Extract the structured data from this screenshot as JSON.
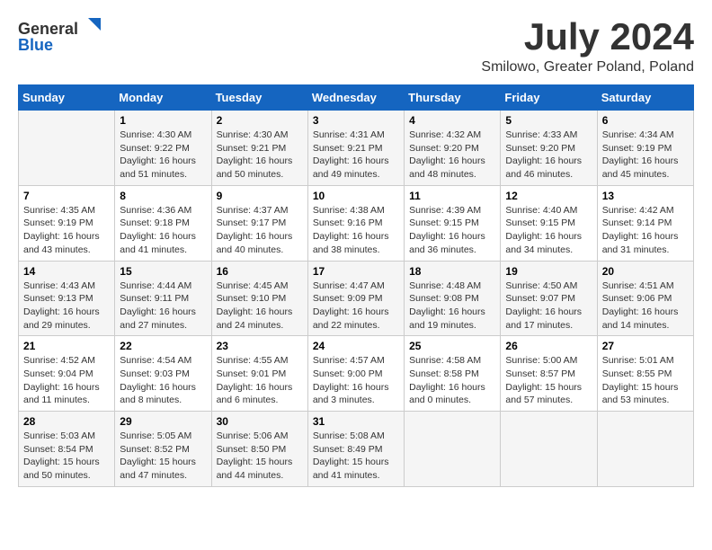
{
  "header": {
    "logo_general": "General",
    "logo_blue": "Blue",
    "month_title": "July 2024",
    "location": "Smilowo, Greater Poland, Poland"
  },
  "weekdays": [
    "Sunday",
    "Monday",
    "Tuesday",
    "Wednesday",
    "Thursday",
    "Friday",
    "Saturday"
  ],
  "weeks": [
    [
      {
        "day": "",
        "sunrise": "",
        "sunset": "",
        "daylight": ""
      },
      {
        "day": "1",
        "sunrise": "Sunrise: 4:30 AM",
        "sunset": "Sunset: 9:22 PM",
        "daylight": "Daylight: 16 hours and 51 minutes."
      },
      {
        "day": "2",
        "sunrise": "Sunrise: 4:30 AM",
        "sunset": "Sunset: 9:21 PM",
        "daylight": "Daylight: 16 hours and 50 minutes."
      },
      {
        "day": "3",
        "sunrise": "Sunrise: 4:31 AM",
        "sunset": "Sunset: 9:21 PM",
        "daylight": "Daylight: 16 hours and 49 minutes."
      },
      {
        "day": "4",
        "sunrise": "Sunrise: 4:32 AM",
        "sunset": "Sunset: 9:20 PM",
        "daylight": "Daylight: 16 hours and 48 minutes."
      },
      {
        "day": "5",
        "sunrise": "Sunrise: 4:33 AM",
        "sunset": "Sunset: 9:20 PM",
        "daylight": "Daylight: 16 hours and 46 minutes."
      },
      {
        "day": "6",
        "sunrise": "Sunrise: 4:34 AM",
        "sunset": "Sunset: 9:19 PM",
        "daylight": "Daylight: 16 hours and 45 minutes."
      }
    ],
    [
      {
        "day": "7",
        "sunrise": "Sunrise: 4:35 AM",
        "sunset": "Sunset: 9:19 PM",
        "daylight": "Daylight: 16 hours and 43 minutes."
      },
      {
        "day": "8",
        "sunrise": "Sunrise: 4:36 AM",
        "sunset": "Sunset: 9:18 PM",
        "daylight": "Daylight: 16 hours and 41 minutes."
      },
      {
        "day": "9",
        "sunrise": "Sunrise: 4:37 AM",
        "sunset": "Sunset: 9:17 PM",
        "daylight": "Daylight: 16 hours and 40 minutes."
      },
      {
        "day": "10",
        "sunrise": "Sunrise: 4:38 AM",
        "sunset": "Sunset: 9:16 PM",
        "daylight": "Daylight: 16 hours and 38 minutes."
      },
      {
        "day": "11",
        "sunrise": "Sunrise: 4:39 AM",
        "sunset": "Sunset: 9:15 PM",
        "daylight": "Daylight: 16 hours and 36 minutes."
      },
      {
        "day": "12",
        "sunrise": "Sunrise: 4:40 AM",
        "sunset": "Sunset: 9:15 PM",
        "daylight": "Daylight: 16 hours and 34 minutes."
      },
      {
        "day": "13",
        "sunrise": "Sunrise: 4:42 AM",
        "sunset": "Sunset: 9:14 PM",
        "daylight": "Daylight: 16 hours and 31 minutes."
      }
    ],
    [
      {
        "day": "14",
        "sunrise": "Sunrise: 4:43 AM",
        "sunset": "Sunset: 9:13 PM",
        "daylight": "Daylight: 16 hours and 29 minutes."
      },
      {
        "day": "15",
        "sunrise": "Sunrise: 4:44 AM",
        "sunset": "Sunset: 9:11 PM",
        "daylight": "Daylight: 16 hours and 27 minutes."
      },
      {
        "day": "16",
        "sunrise": "Sunrise: 4:45 AM",
        "sunset": "Sunset: 9:10 PM",
        "daylight": "Daylight: 16 hours and 24 minutes."
      },
      {
        "day": "17",
        "sunrise": "Sunrise: 4:47 AM",
        "sunset": "Sunset: 9:09 PM",
        "daylight": "Daylight: 16 hours and 22 minutes."
      },
      {
        "day": "18",
        "sunrise": "Sunrise: 4:48 AM",
        "sunset": "Sunset: 9:08 PM",
        "daylight": "Daylight: 16 hours and 19 minutes."
      },
      {
        "day": "19",
        "sunrise": "Sunrise: 4:50 AM",
        "sunset": "Sunset: 9:07 PM",
        "daylight": "Daylight: 16 hours and 17 minutes."
      },
      {
        "day": "20",
        "sunrise": "Sunrise: 4:51 AM",
        "sunset": "Sunset: 9:06 PM",
        "daylight": "Daylight: 16 hours and 14 minutes."
      }
    ],
    [
      {
        "day": "21",
        "sunrise": "Sunrise: 4:52 AM",
        "sunset": "Sunset: 9:04 PM",
        "daylight": "Daylight: 16 hours and 11 minutes."
      },
      {
        "day": "22",
        "sunrise": "Sunrise: 4:54 AM",
        "sunset": "Sunset: 9:03 PM",
        "daylight": "Daylight: 16 hours and 8 minutes."
      },
      {
        "day": "23",
        "sunrise": "Sunrise: 4:55 AM",
        "sunset": "Sunset: 9:01 PM",
        "daylight": "Daylight: 16 hours and 6 minutes."
      },
      {
        "day": "24",
        "sunrise": "Sunrise: 4:57 AM",
        "sunset": "Sunset: 9:00 PM",
        "daylight": "Daylight: 16 hours and 3 minutes."
      },
      {
        "day": "25",
        "sunrise": "Sunrise: 4:58 AM",
        "sunset": "Sunset: 8:58 PM",
        "daylight": "Daylight: 16 hours and 0 minutes."
      },
      {
        "day": "26",
        "sunrise": "Sunrise: 5:00 AM",
        "sunset": "Sunset: 8:57 PM",
        "daylight": "Daylight: 15 hours and 57 minutes."
      },
      {
        "day": "27",
        "sunrise": "Sunrise: 5:01 AM",
        "sunset": "Sunset: 8:55 PM",
        "daylight": "Daylight: 15 hours and 53 minutes."
      }
    ],
    [
      {
        "day": "28",
        "sunrise": "Sunrise: 5:03 AM",
        "sunset": "Sunset: 8:54 PM",
        "daylight": "Daylight: 15 hours and 50 minutes."
      },
      {
        "day": "29",
        "sunrise": "Sunrise: 5:05 AM",
        "sunset": "Sunset: 8:52 PM",
        "daylight": "Daylight: 15 hours and 47 minutes."
      },
      {
        "day": "30",
        "sunrise": "Sunrise: 5:06 AM",
        "sunset": "Sunset: 8:50 PM",
        "daylight": "Daylight: 15 hours and 44 minutes."
      },
      {
        "day": "31",
        "sunrise": "Sunrise: 5:08 AM",
        "sunset": "Sunset: 8:49 PM",
        "daylight": "Daylight: 15 hours and 41 minutes."
      },
      {
        "day": "",
        "sunrise": "",
        "sunset": "",
        "daylight": ""
      },
      {
        "day": "",
        "sunrise": "",
        "sunset": "",
        "daylight": ""
      },
      {
        "day": "",
        "sunrise": "",
        "sunset": "",
        "daylight": ""
      }
    ]
  ]
}
